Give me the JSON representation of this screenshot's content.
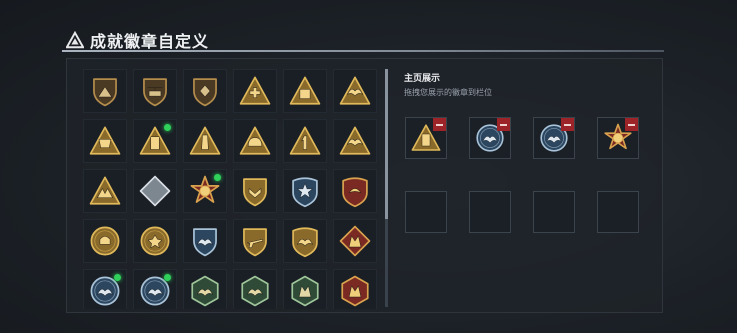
{
  "header": {
    "title": "成就徽章自定义",
    "icon": "triangle-warning-icon"
  },
  "showcase": {
    "title": "主页展示",
    "subtitle": "拖拽您展示的徽章到栏位"
  },
  "colors": {
    "accent": "#c9a14a",
    "new_badge": "#2fd15a",
    "remove": "#9c2428"
  },
  "badges": [
    {
      "icon": "shield-pyramid-icon",
      "shape": "shield",
      "tone": "bronze",
      "glyph": "mountain",
      "new": false
    },
    {
      "icon": "shield-helicopter-icon",
      "shape": "shield",
      "tone": "bronze",
      "glyph": "heli",
      "new": false
    },
    {
      "icon": "shield-emblem-icon",
      "shape": "shield",
      "tone": "bronze",
      "glyph": "diamond",
      "new": false
    },
    {
      "icon": "triangle-medkit-icon",
      "shape": "triangle",
      "tone": "gold",
      "glyph": "plus",
      "new": false
    },
    {
      "icon": "triangle-backpack-icon",
      "shape": "triangle",
      "tone": "gold",
      "glyph": "box",
      "new": false
    },
    {
      "icon": "triangle-eagle-icon",
      "shape": "triangle",
      "tone": "gold",
      "glyph": "wing",
      "new": false
    },
    {
      "icon": "triangle-landmark-icon",
      "shape": "triangle",
      "tone": "gold",
      "glyph": "pillar",
      "new": false
    },
    {
      "icon": "triangle-canister-icon",
      "shape": "triangle",
      "tone": "gold",
      "glyph": "can",
      "new": true
    },
    {
      "icon": "triangle-tower-icon",
      "shape": "triangle",
      "tone": "gold",
      "glyph": "tower",
      "new": false
    },
    {
      "icon": "triangle-helmet-icon",
      "shape": "triangle",
      "tone": "gold",
      "glyph": "helmet",
      "new": false
    },
    {
      "icon": "triangle-number-one-icon",
      "shape": "triangle",
      "tone": "gold",
      "glyph": "one",
      "new": false
    },
    {
      "icon": "triangle-wings-icon",
      "shape": "triangle",
      "tone": "gold",
      "glyph": "wing",
      "new": false
    },
    {
      "icon": "triangle-arrows-icon",
      "shape": "triangle",
      "tone": "gold",
      "glyph": "arrows",
      "new": false
    },
    {
      "icon": "diamond-silver-icon",
      "shape": "diamond",
      "tone": "silver",
      "glyph": "none",
      "new": false
    },
    {
      "icon": "star-medal-icon",
      "shape": "starmedal",
      "tone": "red",
      "glyph": "star",
      "new": true
    },
    {
      "icon": "shield-chevron-icon",
      "shape": "shield",
      "tone": "gold",
      "glyph": "chevron",
      "new": false
    },
    {
      "icon": "blue-star-shield-icon",
      "shape": "crest",
      "tone": "blue",
      "glyph": "star",
      "new": false
    },
    {
      "icon": "red-crest-icon",
      "shape": "crest",
      "tone": "red",
      "glyph": "bird",
      "new": false
    },
    {
      "icon": "circle-skull-icon",
      "shape": "circle",
      "tone": "gold",
      "glyph": "skull",
      "new": false
    },
    {
      "icon": "circle-rosette-icon",
      "shape": "circle",
      "tone": "gold",
      "glyph": "rosette",
      "new": false
    },
    {
      "icon": "blue-eagle-shield-icon",
      "shape": "shield",
      "tone": "blue",
      "glyph": "wing",
      "new": false
    },
    {
      "icon": "shield-rifle-icon",
      "shape": "shield",
      "tone": "gold",
      "glyph": "rifle",
      "new": false
    },
    {
      "icon": "gold-eagle-crest-icon",
      "shape": "crest",
      "tone": "gold",
      "glyph": "wing",
      "new": false
    },
    {
      "icon": "diamond-wolf-icon",
      "shape": "diamond",
      "tone": "red",
      "glyph": "wolf",
      "new": false
    },
    {
      "icon": "circle-eagle-blue-icon",
      "shape": "circle",
      "tone": "blue",
      "glyph": "wing",
      "new": true
    },
    {
      "icon": "circle-eagle-blue-2-icon",
      "shape": "circle",
      "tone": "blue",
      "glyph": "wing",
      "new": true
    },
    {
      "icon": "hex-soldier-green-icon",
      "shape": "hex",
      "tone": "green",
      "glyph": "wing",
      "new": false
    },
    {
      "icon": "hex-runner-green-icon",
      "shape": "hex",
      "tone": "green",
      "glyph": "wing",
      "new": false
    },
    {
      "icon": "hex-wolf-green-icon",
      "shape": "hex",
      "tone": "green",
      "glyph": "wolf",
      "new": false
    },
    {
      "icon": "hex-ember-icon",
      "shape": "hex",
      "tone": "red",
      "glyph": "wolf",
      "new": false
    }
  ],
  "slots": [
    {
      "filled": true,
      "icon": "triangle-canister-icon",
      "shape": "triangle",
      "tone": "gold",
      "glyph": "can"
    },
    {
      "filled": true,
      "icon": "circle-eagle-blue-icon",
      "shape": "circle",
      "tone": "blue",
      "glyph": "wing"
    },
    {
      "filled": true,
      "icon": "circle-eagle-blue-2-icon",
      "shape": "circle",
      "tone": "blue",
      "glyph": "wing"
    },
    {
      "filled": true,
      "icon": "star-medal-icon",
      "shape": "starmedal",
      "tone": "red",
      "glyph": "star"
    },
    {
      "filled": false
    },
    {
      "filled": false
    },
    {
      "filled": false
    },
    {
      "filled": false
    }
  ]
}
